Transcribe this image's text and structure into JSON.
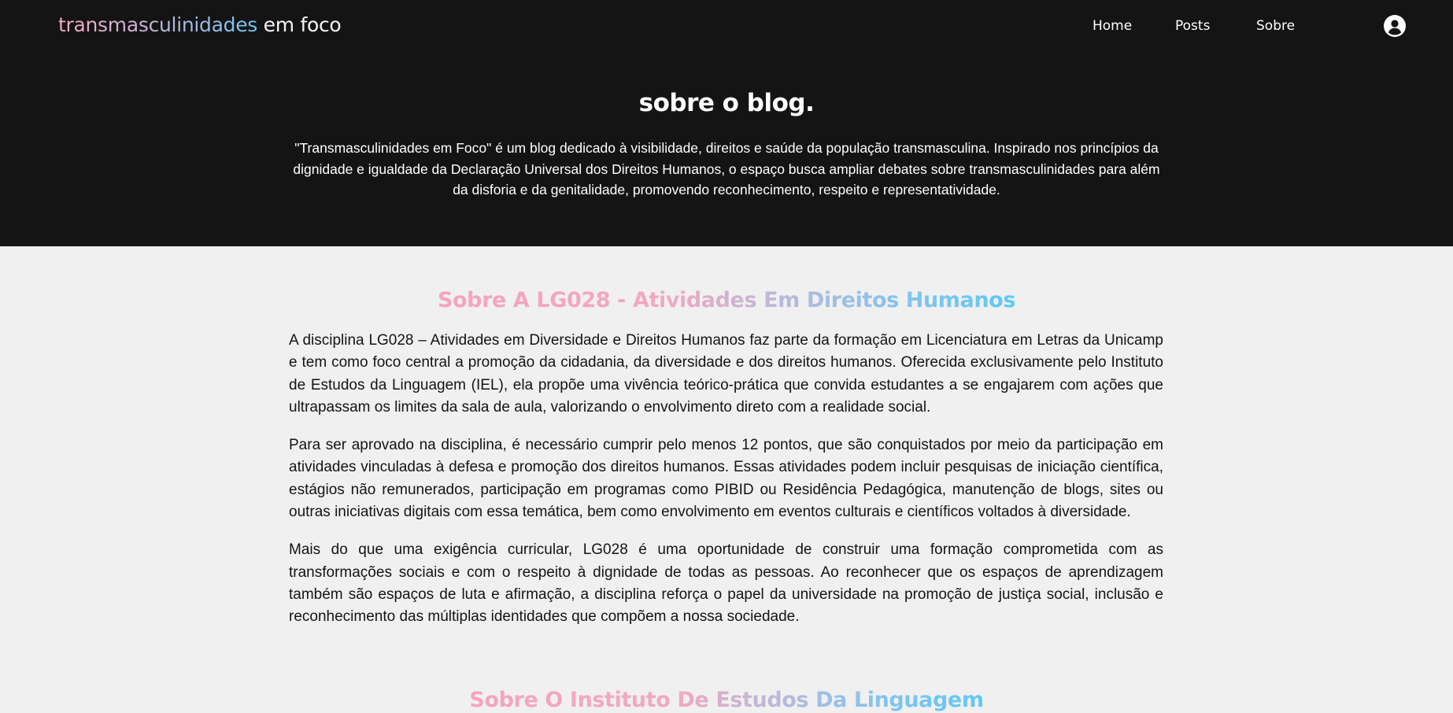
{
  "nav": {
    "logo_gradient": "transmasculinidades",
    "logo_rest": " em foco",
    "links": [
      "Home",
      "Posts",
      "Sobre"
    ],
    "user_icon": "user-circle-icon"
  },
  "hero": {
    "title": "sobre o blog.",
    "text": "\"Transmasculinidades em Foco\" é um blog dedicado à visibilidade, direitos e saúde da população transmasculina. Inspirado nos princípios da dignidade e igualdade da Declaração Universal dos Direitos Humanos, o espaço busca ampliar debates sobre transmasculinidades para além da disforia e da genitalidade, promovendo reconhecimento, respeito e representatividade."
  },
  "sections": [
    {
      "title": "Sobre A LG028 - Atividades Em Direitos Humanos",
      "paragraphs": [
        "A disciplina LG028 – Atividades em Diversidade e Direitos Humanos faz parte da formação em Licenciatura em Letras da Unicamp e tem como foco central a promoção da cidadania, da diversidade e dos direitos humanos. Oferecida exclusivamente pelo Instituto de Estudos da Linguagem (IEL), ela propõe uma vivência teórico-prática que convida estudantes a se engajarem com ações que ultrapassam os limites da sala de aula, valorizando o envolvimento direto com a realidade social.",
        "Para ser aprovado na disciplina, é necessário cumprir pelo menos 12 pontos, que são conquistados por meio da participação em atividades vinculadas à defesa e promoção dos direitos humanos. Essas atividades podem incluir pesquisas de iniciação científica, estágios não remunerados, participação em programas como PIBID ou Residência Pedagógica, manutenção de blogs, sites ou outras iniciativas digitais com essa temática, bem como envolvimento em eventos culturais e científicos voltados à diversidade.",
        "Mais do que uma exigência curricular, LG028 é uma oportunidade de construir uma formação comprometida com as transformações sociais e com o respeito à dignidade de todas as pessoas. Ao reconhecer que os espaços de aprendizagem também são espaços de luta e afirmação, a disciplina reforça o papel da universidade na promoção de justiça social, inclusão e reconhecimento das múltiplas identidades que compõem a nossa sociedade."
      ]
    },
    {
      "title": "Sobre O Instituto De Estudos Da Linguagem"
    }
  ],
  "colors": {
    "hero_bg": "#141414",
    "page_bg": "#f0f0f0",
    "gradient_pink": "#f6a8c0",
    "gradient_blue": "#5ec9f7"
  }
}
